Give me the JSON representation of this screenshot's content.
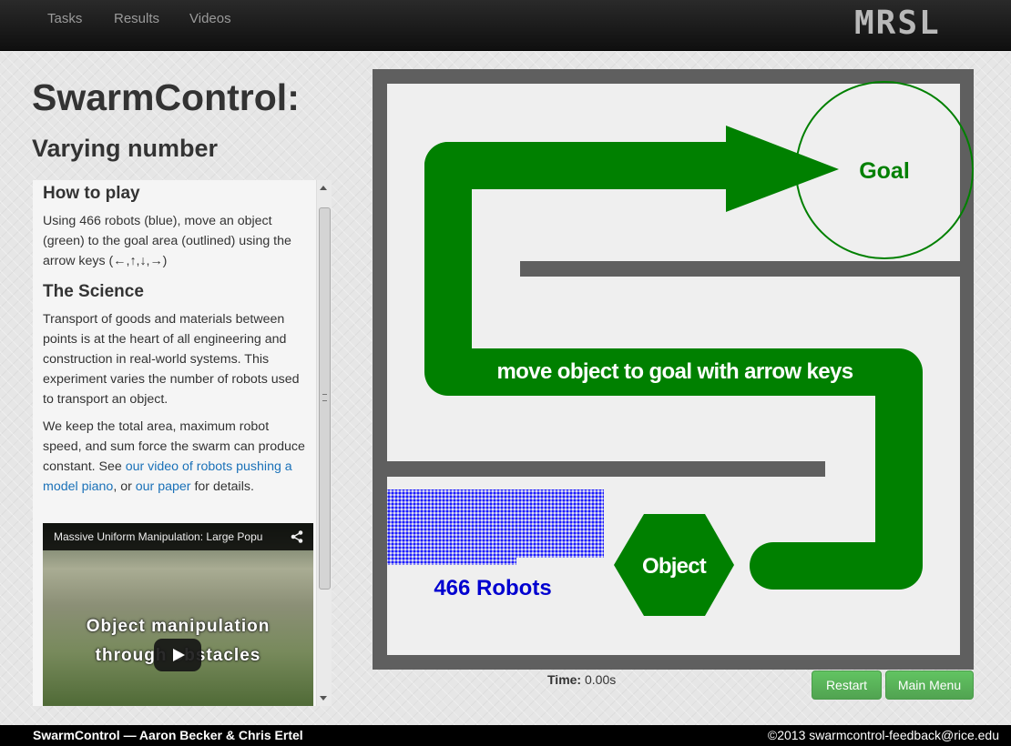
{
  "nav": {
    "links": [
      "Tasks",
      "Results",
      "Videos"
    ],
    "logo_text": "MRSL"
  },
  "page": {
    "title": "SwarmControl:",
    "subtitle": "Varying number"
  },
  "info": {
    "how_heading": "How to play",
    "how_text": "Using 466 robots (blue), move an object (green) to the goal area (outlined) using the arrow keys (←,↑,↓,→)",
    "science_heading": "The Science",
    "science_p1": "Transport of goods and materials between points is at the heart of all engineering and construction in real-world systems. This experiment varies the number of robots used to transport an object.",
    "science_p2_before": "We keep the total area, maximum robot speed, and sum force the swarm can produce constant. See ",
    "science_p2_link1": "our video of robots pushing a model piano",
    "science_p2_mid": ", or ",
    "science_p2_link2": "our paper",
    "science_p2_after": " for details."
  },
  "video": {
    "title": "Massive Uniform Manipulation: Large Popu",
    "caption_line1": "Object manipulation",
    "caption_line2": "through obstacles"
  },
  "game": {
    "goal_label": "Goal",
    "instruction": "move object to goal with arrow keys",
    "object_label": "Object",
    "robots_label": "466 Robots",
    "colors": {
      "frame": "#5f5f5f",
      "field": "#efefef",
      "green": "#008000",
      "robot_blue": "#1b1bff",
      "robot_text": "#0000d0"
    }
  },
  "status": {
    "time_label": "Time:",
    "time_value": "0.00s"
  },
  "buttons": {
    "restart": "Restart",
    "main_menu": "Main Menu"
  },
  "footer": {
    "left": "SwarmControl — Aaron Becker & Chris Ertel",
    "right": "©2013 swarmcontrol-feedback@rice.edu"
  }
}
